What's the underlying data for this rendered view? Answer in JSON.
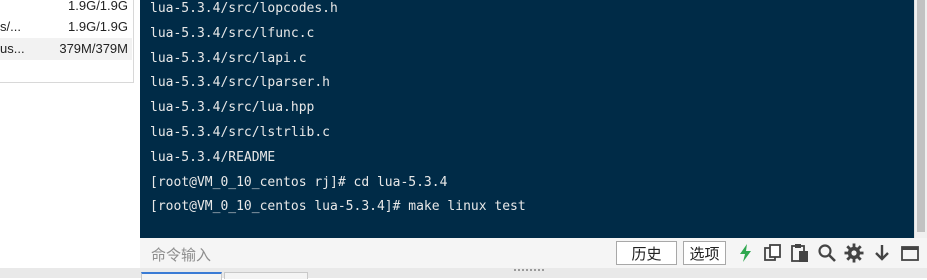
{
  "disk_panel": {
    "rows": [
      {
        "name": "",
        "size": "1.9G/1.9G"
      },
      {
        "name": "s/...",
        "size": "1.9G/1.9G"
      },
      {
        "name": "us...",
        "size": "379M/379M"
      }
    ]
  },
  "terminal": {
    "lines": [
      "lua-5.3.4/src/lopcodes.h",
      "lua-5.3.4/src/lfunc.c",
      "lua-5.3.4/src/lapi.c",
      "lua-5.3.4/src/lparser.h",
      "lua-5.3.4/src/lua.hpp",
      "lua-5.3.4/src/lstrlib.c",
      "lua-5.3.4/README",
      "[root@VM_0_10_centos rj]# cd lua-5.3.4",
      "[root@VM_0_10_centos lua-5.3.4]# make linux test"
    ],
    "background": "#002b47",
    "text_color": "#e8e8e8"
  },
  "command_bar": {
    "input_placeholder": "命令输入",
    "history_button": "历史",
    "options_button": "选项",
    "tools": [
      "lightning-icon",
      "copy-icon",
      "paste-icon",
      "search-icon",
      "gear-icon",
      "download-arrow-icon",
      "window-icon"
    ],
    "lightning_color": "#2fa84f"
  }
}
